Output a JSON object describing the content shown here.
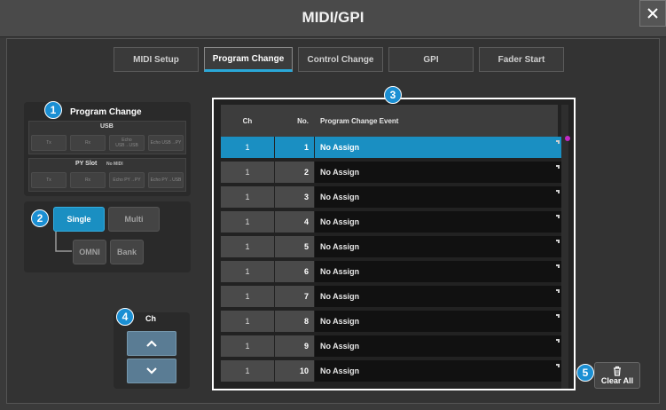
{
  "window": {
    "title": "MIDI/GPI"
  },
  "tabs": [
    {
      "label": "MIDI Setup",
      "active": false
    },
    {
      "label": "Program Change",
      "active": true
    },
    {
      "label": "Control Change",
      "active": false
    },
    {
      "label": "GPI",
      "active": false
    },
    {
      "label": "Fader Start",
      "active": false
    }
  ],
  "program_change_panel": {
    "heading": "Program Change",
    "usb": {
      "label": "USB",
      "buttons": [
        "Tx",
        "Rx",
        "Echo USB→USB",
        "Echo USB→PY"
      ]
    },
    "py_slot": {
      "label": "PY Slot",
      "note": "No MIDI",
      "buttons": [
        "Tx",
        "Rx",
        "Echo PY→PY",
        "Echo PY→USB"
      ]
    }
  },
  "mode_panel": {
    "buttons": [
      {
        "label": "Single",
        "selected": true
      },
      {
        "label": "Multi",
        "selected": false
      },
      {
        "label": "OMNI",
        "selected": false
      },
      {
        "label": "Bank",
        "selected": false
      }
    ]
  },
  "channel_panel": {
    "label": "Ch",
    "up_icon": "chevron-up-icon",
    "down_icon": "chevron-down-icon"
  },
  "table": {
    "columns": [
      "Ch",
      "No.",
      "Program Change Event"
    ],
    "rows": [
      {
        "ch": "1",
        "no": "1",
        "event": "No Assign",
        "selected": true
      },
      {
        "ch": "1",
        "no": "2",
        "event": "No Assign",
        "selected": false
      },
      {
        "ch": "1",
        "no": "3",
        "event": "No Assign",
        "selected": false
      },
      {
        "ch": "1",
        "no": "4",
        "event": "No Assign",
        "selected": false
      },
      {
        "ch": "1",
        "no": "5",
        "event": "No Assign",
        "selected": false
      },
      {
        "ch": "1",
        "no": "6",
        "event": "No Assign",
        "selected": false
      },
      {
        "ch": "1",
        "no": "7",
        "event": "No Assign",
        "selected": false
      },
      {
        "ch": "1",
        "no": "8",
        "event": "No Assign",
        "selected": false
      },
      {
        "ch": "1",
        "no": "9",
        "event": "No Assign",
        "selected": false
      },
      {
        "ch": "1",
        "no": "10",
        "event": "No Assign",
        "selected": false
      }
    ]
  },
  "clear_all": {
    "label": "Clear All",
    "icon": "trash-icon"
  },
  "callouts": [
    "1",
    "2",
    "3",
    "4",
    "5"
  ],
  "colors": {
    "accent": "#1a8fc2",
    "callout": "#1b8fd3",
    "highlight_frame": "#ffffff"
  }
}
